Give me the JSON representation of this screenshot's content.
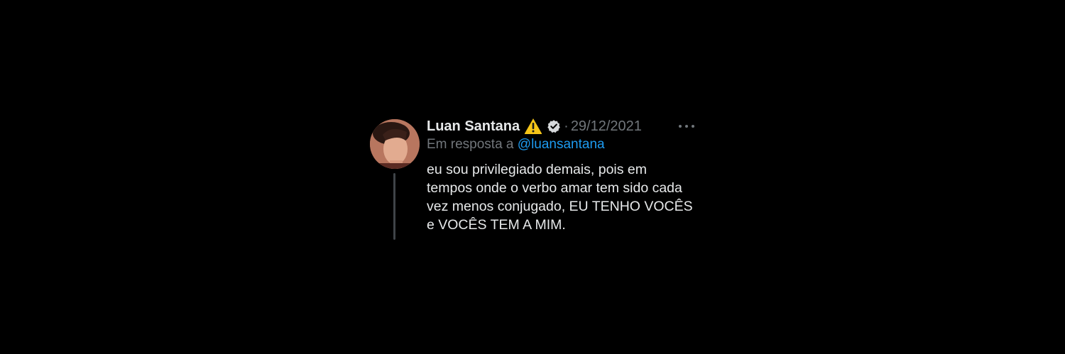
{
  "tweet": {
    "author_name": "Luan Santana",
    "badge_emoji_icon": "warning-icon",
    "verified_icon": "verified-badge-icon",
    "separator": "·",
    "date": "29/12/2021",
    "more_icon": "more-horizontal-icon",
    "reply_prefix": "Em resposta a",
    "reply_handle": "@luansantana",
    "body_lines": [
      "eu sou privilegiado demais, pois em",
      "tempos onde o verbo amar tem sido cada",
      "vez menos conjugado, EU TENHO VOCÊS",
      "e VOCÊS TEM A MIM."
    ]
  },
  "colors": {
    "background": "#000000",
    "primary_text": "#e7e9ea",
    "secondary_text": "#71767b",
    "link": "#1d9bf0",
    "thread_line": "#3f4448",
    "warning": "#f5c518"
  }
}
